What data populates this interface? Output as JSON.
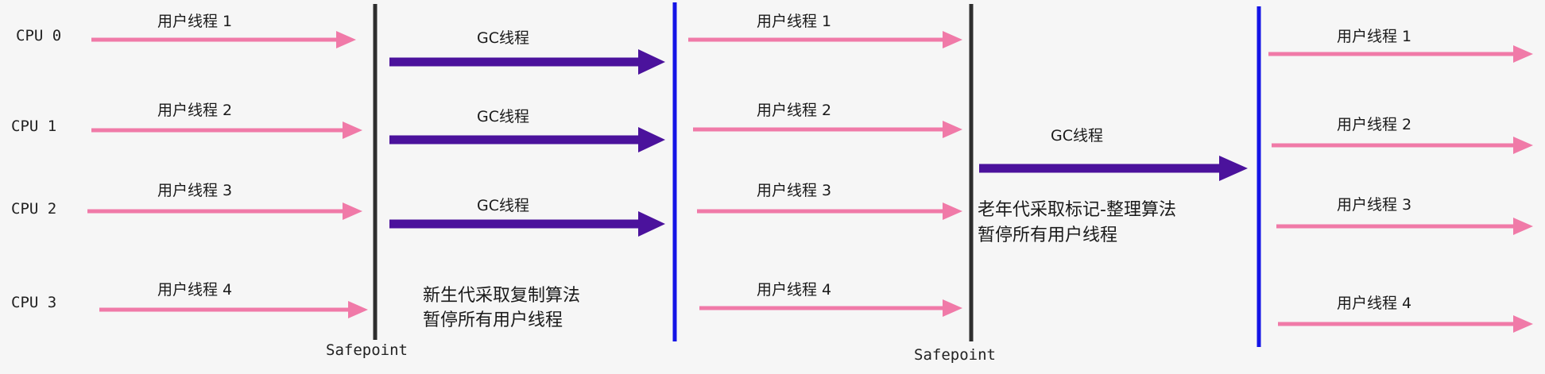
{
  "cpus": [
    "CPU 0",
    "CPU 1",
    "CPU 2",
    "CPU 3"
  ],
  "phase1_threads": [
    "用户线程 1",
    "用户线程 2",
    "用户线程 3",
    "用户线程 4"
  ],
  "young_gc": {
    "threads": [
      "GC线程",
      "GC线程",
      "GC线程"
    ],
    "note": [
      "新生代采取复制算法",
      "暂停所有用户线程"
    ]
  },
  "phase2_threads": [
    "用户线程 1",
    "用户线程 2",
    "用户线程 3",
    "用户线程 4"
  ],
  "old_gc": {
    "thread": "GC线程",
    "note": [
      "老年代采取标记-整理算法",
      "暂停所有用户线程"
    ]
  },
  "phase3_threads": [
    "用户线程 1",
    "用户线程 2",
    "用户线程 3",
    "用户线程 4"
  ],
  "safepoints": [
    "Safepoint",
    "Safepoint"
  ],
  "colors": {
    "user_thread": "#f07aa8",
    "gc_thread": "#4b129c",
    "safepoint_line": "#2e2e2e",
    "gc_end_line": "#1414e6"
  }
}
